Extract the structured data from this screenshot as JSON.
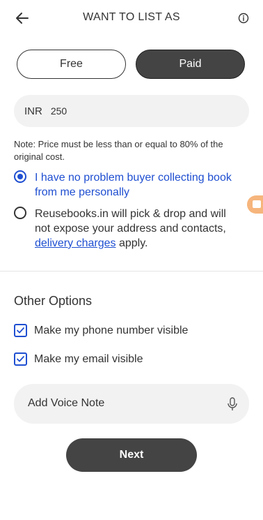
{
  "header": {
    "title": "WANT TO LIST AS",
    "back_icon": "arrow-left-icon",
    "info_icon": "info-circle-icon"
  },
  "listing_type": {
    "options": [
      "Free",
      "Paid"
    ],
    "selected": "Paid"
  },
  "price": {
    "currency": "INR",
    "value": "250"
  },
  "note": "Note: Price must be less than or equal to 80% of the original cost.",
  "delivery_options": {
    "option1": "I have no problem buyer collecting book from me personally",
    "option2_prefix": "Reusebooks.in will pick & drop and will not expose your address  and contacts, ",
    "option2_link": "delivery charges",
    "option2_suffix": " apply.",
    "selected": "option1"
  },
  "other_options": {
    "title": "Other Options",
    "phone_visible_label": "Make my phone number visible",
    "email_visible_label": "Make my email visible",
    "phone_visible_checked": true,
    "email_visible_checked": true
  },
  "voice_note": {
    "label": "Add Voice Note",
    "icon": "microphone-icon"
  },
  "next_label": "Next",
  "colors": {
    "accent": "#1f4fd1",
    "dark_button": "#444444",
    "input_bg": "#f2f2f2",
    "floating_tab": "#f6b57c"
  }
}
